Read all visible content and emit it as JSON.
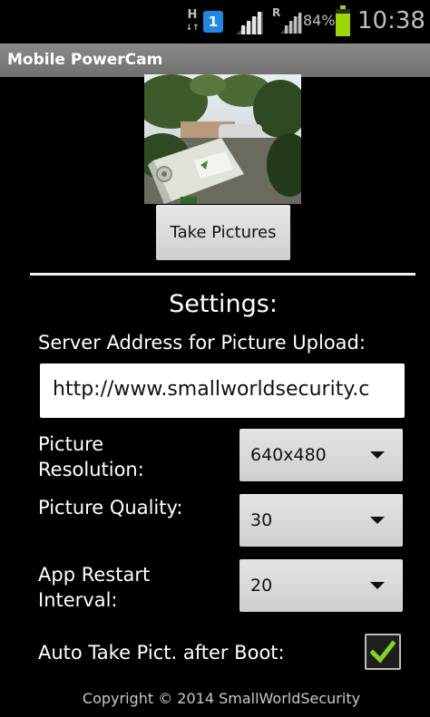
{
  "status_bar": {
    "network_type": "H",
    "notification_badge": "1",
    "roaming_indicator": "R",
    "battery_percent": "84%",
    "battery_level": 0.84,
    "time": "10:38",
    "icons": [
      "data-h-icon",
      "notification-badge-icon",
      "signal-icon",
      "roaming-signal-icon",
      "battery-icon"
    ]
  },
  "app": {
    "title": "Mobile PowerCam"
  },
  "camera": {
    "take_pictures_label": "Take Pictures"
  },
  "settings": {
    "title": "Settings:",
    "server_label": "Server Address for Picture Upload:",
    "server_value": "http://www.smallworldsecurity.c",
    "resolution_label_1": "Picture",
    "resolution_label_2": "Resolution:",
    "resolution_value": "640x480",
    "quality_label": "Picture Quality:",
    "quality_value": "30",
    "restart_label_1": "App Restart",
    "restart_label_2": "Interval:",
    "restart_value": "20",
    "auto_label": "Auto Take Pict. after Boot:",
    "auto_checked": true
  },
  "footer": {
    "copyright": "Copyright © 2014 SmallWorldSecurity"
  },
  "colors": {
    "background": "#000000",
    "title_bar": "#7d7d7d",
    "checkmark": "#7fd321",
    "battery": "#9bd800",
    "notification": "#1e88e5"
  }
}
